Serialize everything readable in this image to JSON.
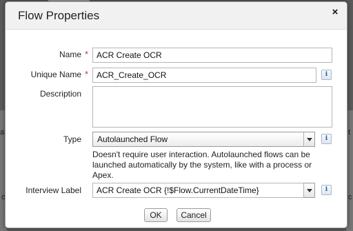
{
  "background": {
    "left_fragment_1": "at",
    "left_fragment_2": "o",
    "right_fragment_1": "t",
    "right_fragment_2": "c"
  },
  "dialog": {
    "title": "Flow Properties",
    "close_label": "×"
  },
  "fields": {
    "name": {
      "label": "Name",
      "required_marker": "*",
      "value": "ACR Create OCR"
    },
    "unique_name": {
      "label": "Unique Name",
      "required_marker": "*",
      "value": "ACR_Create_OCR",
      "info_label": "i"
    },
    "description": {
      "label": "Description",
      "value": ""
    },
    "type": {
      "label": "Type",
      "selected": "Autolaunched Flow",
      "info_label": "i",
      "help_text": "Doesn't require user interaction. Autolaunched flows can be launched automatically by the system, like with a process or Apex."
    },
    "interview_label": {
      "label": "Interview Label",
      "value": "ACR Create OCR {!$Flow.CurrentDateTime}",
      "info_label": "i"
    }
  },
  "buttons": {
    "ok": "OK",
    "cancel": "Cancel"
  },
  "colors": {
    "required": "#c23934",
    "info_icon": "#1a5fa8"
  }
}
